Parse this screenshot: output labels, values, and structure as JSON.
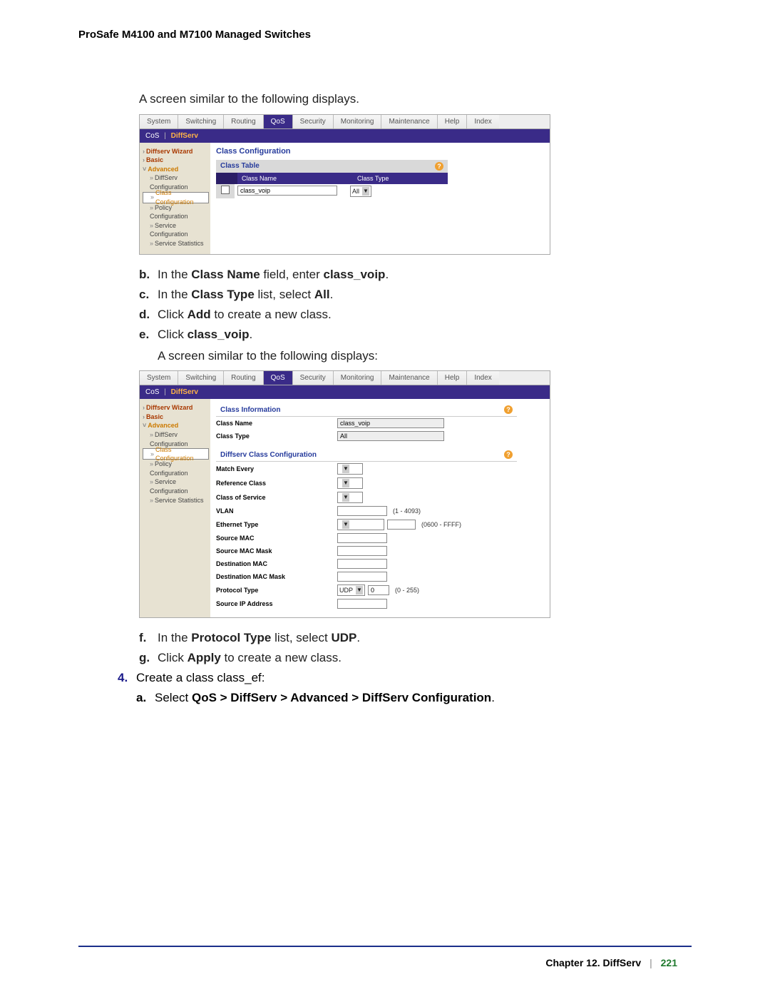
{
  "doc_title": "ProSafe M4100 and M7100 Managed Switches",
  "intro1": "A screen similar to the following displays.",
  "intro2": "A screen similar to the following displays:",
  "steps_letters_1": {
    "b": {
      "pre": "In the ",
      "b1": "Class Name",
      "mid": " field, enter ",
      "b2": "class_voip",
      "post": "."
    },
    "c": {
      "pre": "In the ",
      "b1": "Class Type",
      "mid": " list, select ",
      "b2": "All",
      "post": "."
    },
    "d": {
      "pre": "Click ",
      "b1": "Add",
      "post": " to create a new class."
    },
    "e": {
      "pre": "Click ",
      "b1": "class_voip",
      "post": "."
    }
  },
  "steps_letters_2": {
    "f": {
      "pre": "In the ",
      "b1": "Protocol Type",
      "mid": " list, select ",
      "b2": "UDP",
      "post": "."
    },
    "g": {
      "pre": "Click ",
      "b1": "Apply",
      "post": " to create a new class."
    }
  },
  "step4": {
    "num": "4.",
    "text": "Create a class class_ef:",
    "a": {
      "pre": "Select ",
      "b1": "QoS > DiffServ > Advanced > DiffServ Configuration",
      "post": "."
    }
  },
  "shot_tabs": [
    "System",
    "Switching",
    "Routing",
    "QoS",
    "Security",
    "Monitoring",
    "Maintenance",
    "Help",
    "Index"
  ],
  "shot_subtabs": {
    "a": "CoS",
    "b": "DiffServ"
  },
  "sidenav": {
    "wizard": "Diffserv Wizard",
    "basic": "Basic",
    "advanced": "Advanced",
    "diffserv_conf": "DiffServ Configuration",
    "class_conf": "Class Configuration",
    "policy_conf": "Policy Configuration",
    "service_conf": "Service Configuration",
    "service_stats": "Service Statistics"
  },
  "shot1": {
    "title": "Class Configuration",
    "panel": "Class Table",
    "col1": "Class Name",
    "col2": "Class Type",
    "row_name": "class_voip",
    "row_type": "All"
  },
  "shot2": {
    "title1": "Class Information",
    "k_class_name": "Class Name",
    "v_class_name": "class_voip",
    "k_class_type": "Class Type",
    "v_class_type": "All",
    "title2": "Diffserv Class Configuration",
    "k_match_every": "Match Every",
    "k_ref_class": "Reference Class",
    "k_cos": "Class of Service",
    "k_vlan": "VLAN",
    "hint_vlan": "(1 - 4093)",
    "k_eth_type": "Ethernet Type",
    "hint_eth": "(0600 - FFFF)",
    "k_src_mac": "Source MAC",
    "k_src_mac_mask": "Source MAC Mask",
    "k_dst_mac": "Destination MAC",
    "k_dst_mac_mask": "Destination MAC Mask",
    "k_proto_type": "Protocol Type",
    "v_proto_type": "UDP",
    "v_proto_num": "0",
    "hint_proto": "(0 - 255)",
    "k_src_ip": "Source IP Address"
  },
  "footer": {
    "chapter": "Chapter 12.  DiffServ",
    "page": "221"
  }
}
